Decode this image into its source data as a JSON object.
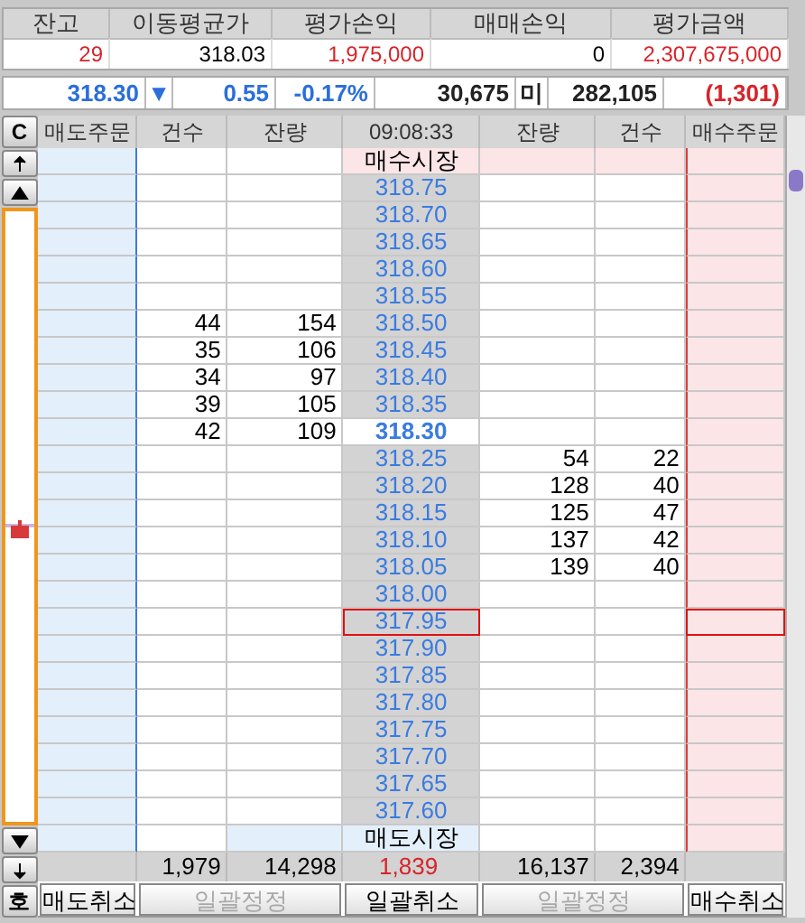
{
  "summary": {
    "columns": [
      {
        "label": "잔고",
        "value": "29",
        "color": "#d8232a"
      },
      {
        "label": "이동평균가",
        "value": "318.03",
        "color": "#000000"
      },
      {
        "label": "평가손익",
        "value": "1,975,000",
        "color": "#d8232a"
      },
      {
        "label": "매매손익",
        "value": "0",
        "color": "#000000"
      },
      {
        "label": "평가금액",
        "value": "2,307,675,000",
        "color": "#d8232a"
      }
    ]
  },
  "quote": {
    "price": "318.30",
    "direction_symbol": "▼",
    "change": "0.55",
    "change_rate": "-0.17%",
    "volume": "30,675",
    "open_interest_label": "미",
    "open_interest": "282,105",
    "open_interest_change": "(1,301)"
  },
  "order_book": {
    "clear_button": "C",
    "columns": [
      "매도주문",
      "건수",
      "잔량",
      "09:08:33",
      "잔량",
      "건수",
      "매수주문"
    ],
    "rows": [
      {
        "kind": "buy_market",
        "label": "매수시장",
        "selected": false
      },
      {
        "kind": "price",
        "price": "318.75",
        "selected": false
      },
      {
        "kind": "price",
        "price": "318.70",
        "selected": false
      },
      {
        "kind": "price",
        "price": "318.65",
        "selected": false
      },
      {
        "kind": "price",
        "price": "318.60",
        "selected": false
      },
      {
        "kind": "price",
        "price": "318.55",
        "selected": false
      },
      {
        "kind": "price",
        "price": "318.50",
        "sell_count": "44",
        "sell_qty": "154",
        "selected": false
      },
      {
        "kind": "price",
        "price": "318.45",
        "sell_count": "35",
        "sell_qty": "106",
        "selected": false
      },
      {
        "kind": "price",
        "price": "318.40",
        "sell_count": "34",
        "sell_qty": "97",
        "selected": false
      },
      {
        "kind": "price",
        "price": "318.35",
        "sell_count": "39",
        "sell_qty": "105",
        "selected": false
      },
      {
        "kind": "current",
        "price": "318.30",
        "sell_count": "42",
        "sell_qty": "109",
        "selected": false
      },
      {
        "kind": "price",
        "price": "318.25",
        "buy_qty": "54",
        "buy_count": "22",
        "selected": false
      },
      {
        "kind": "price",
        "price": "318.20",
        "buy_qty": "128",
        "buy_count": "40",
        "selected": false
      },
      {
        "kind": "price",
        "price": "318.15",
        "buy_qty": "125",
        "buy_count": "47",
        "selected": false
      },
      {
        "kind": "price",
        "price": "318.10",
        "buy_qty": "137",
        "buy_count": "42",
        "selected": false
      },
      {
        "kind": "price",
        "price": "318.05",
        "buy_qty": "139",
        "buy_count": "40",
        "selected": false
      },
      {
        "kind": "price",
        "price": "318.00",
        "selected": false
      },
      {
        "kind": "price",
        "price": "317.95",
        "selected": true
      },
      {
        "kind": "price",
        "price": "317.90",
        "selected": false
      },
      {
        "kind": "price",
        "price": "317.85",
        "selected": false
      },
      {
        "kind": "price",
        "price": "317.80",
        "selected": false
      },
      {
        "kind": "price",
        "price": "317.75",
        "selected": false
      },
      {
        "kind": "price",
        "price": "317.70",
        "selected": false
      },
      {
        "kind": "price",
        "price": "317.65",
        "selected": false
      },
      {
        "kind": "price",
        "price": "317.60",
        "selected": false
      },
      {
        "kind": "sell_market",
        "label": "매도시장",
        "selected": false
      }
    ],
    "totals": {
      "sell_count": "1,979",
      "sell_qty": "14,298",
      "difference": "1,839",
      "buy_qty": "16,137",
      "buy_count": "2,394"
    },
    "rail_bottom_button": "호",
    "buttons": [
      {
        "label": "매도취소",
        "disabled": false
      },
      {
        "label": "일괄정정",
        "disabled": true
      },
      {
        "label": "일괄취소",
        "disabled": false
      },
      {
        "label": "일괄정정",
        "disabled": true
      },
      {
        "label": "매수취소",
        "disabled": false
      }
    ]
  }
}
